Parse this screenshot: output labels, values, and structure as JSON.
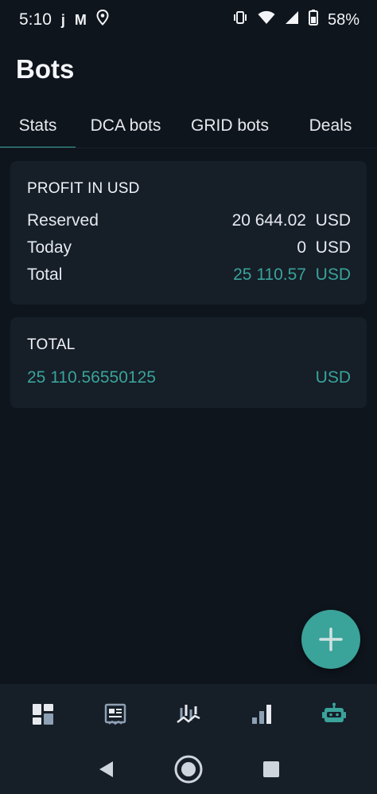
{
  "status_bar": {
    "time": "5:10",
    "notif_icons": [
      "j",
      "M",
      "location-pin"
    ],
    "battery_percent": "58%"
  },
  "header": {
    "title": "Bots"
  },
  "tabs": [
    {
      "label": "Stats",
      "active": true
    },
    {
      "label": "DCA bots",
      "active": false
    },
    {
      "label": "GRID bots",
      "active": false
    },
    {
      "label": "Deals",
      "active": false
    }
  ],
  "profit_card": {
    "title": "PROFIT IN USD",
    "rows": [
      {
        "label": "Reserved",
        "value": "20 644.02",
        "currency": "USD"
      },
      {
        "label": "Today",
        "value": "0",
        "currency": "USD"
      },
      {
        "label": "Total",
        "value": "25 110.57",
        "currency": "USD"
      }
    ]
  },
  "total_card": {
    "title": "TOTAL",
    "value": "25 110.56550125",
    "currency": "USD"
  },
  "fab": {
    "icon": "plus-icon"
  },
  "bottom_nav": [
    {
      "icon": "dashboard-icon",
      "active": false
    },
    {
      "icon": "news-icon",
      "active": false
    },
    {
      "icon": "trading-chart-icon",
      "active": false
    },
    {
      "icon": "bar-chart-icon",
      "active": false
    },
    {
      "icon": "bot-icon",
      "active": true
    }
  ],
  "colors": {
    "background": "#0f151d",
    "card": "#161e28",
    "accent": "#3aa39a",
    "text": "#e6e9ee"
  }
}
